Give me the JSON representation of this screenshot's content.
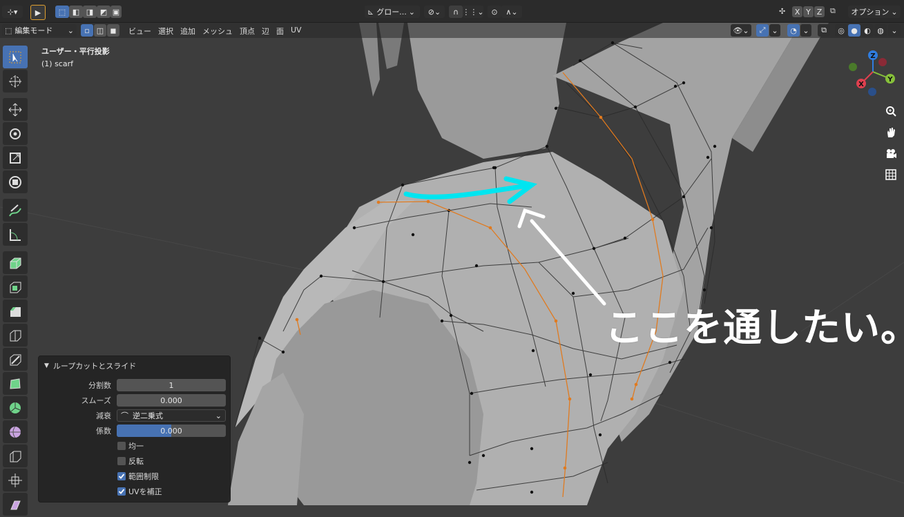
{
  "topbar": {
    "transform_orientation": "グロー...",
    "axis_x": "X",
    "axis_y": "Y",
    "axis_z": "Z",
    "options": "オプション"
  },
  "header": {
    "mode": "編集モード",
    "menus": [
      "ビュー",
      "選択",
      "追加",
      "メッシュ",
      "頂点",
      "辺",
      "面",
      "UV"
    ]
  },
  "viewport": {
    "view_name": "ユーザー・平行投影",
    "object_name": "(1) scarf",
    "annotation": "ここを通したい。",
    "gizmo": {
      "x": "X",
      "y": "Y",
      "z": "Z"
    }
  },
  "panel": {
    "title": "ループカットとスライド",
    "fields": [
      {
        "label": "分割数",
        "value": "1"
      },
      {
        "label": "スムーズ",
        "value": "0.000"
      },
      {
        "label": "減衰",
        "value": "逆二乗式"
      },
      {
        "label": "係数",
        "value": "0.000"
      }
    ],
    "factor_fill": 0.5,
    "checks": [
      {
        "label": "均一",
        "checked": false
      },
      {
        "label": "反転",
        "checked": false
      },
      {
        "label": "範囲制限",
        "checked": true
      },
      {
        "label": "UVを補正",
        "checked": true
      }
    ]
  },
  "colors": {
    "accent": "#4772b3",
    "annotation_arrow": "#00e5f0",
    "selected_edge": "#e07a1f"
  }
}
